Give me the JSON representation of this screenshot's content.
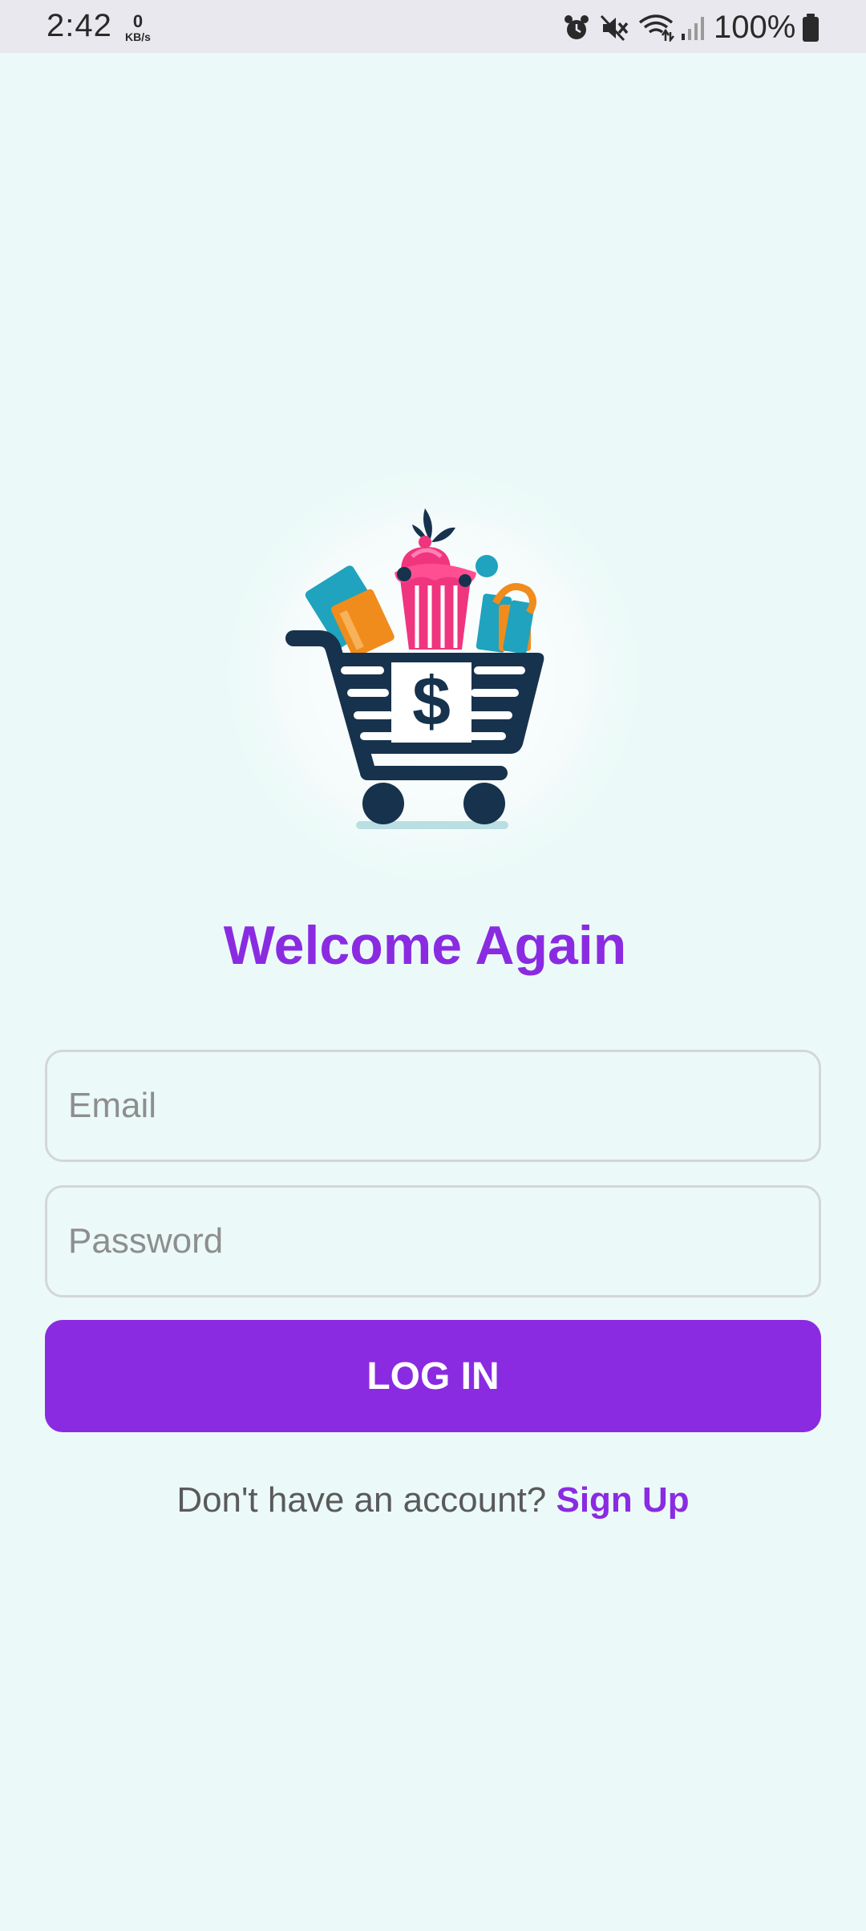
{
  "status_bar": {
    "time": "2:42",
    "net_speed_value": "0",
    "net_speed_unit": "KB/s",
    "icons": [
      "alarm-icon",
      "mute-icon",
      "wifi-icon",
      "signal-icon",
      "battery-icon"
    ],
    "battery_percent": "100%"
  },
  "logo": {
    "icon": "shopping-cart-logo"
  },
  "login": {
    "title": "Welcome Again",
    "email_placeholder": "Email",
    "email_value": "",
    "password_placeholder": "Password",
    "password_value": "",
    "button_label": "LOG IN",
    "signup_prompt": "Don't have an account?",
    "signup_link": "Sign Up"
  },
  "colors": {
    "background": "#ebfaf8",
    "accent": "#8a2be2",
    "cart": "#17324d"
  }
}
